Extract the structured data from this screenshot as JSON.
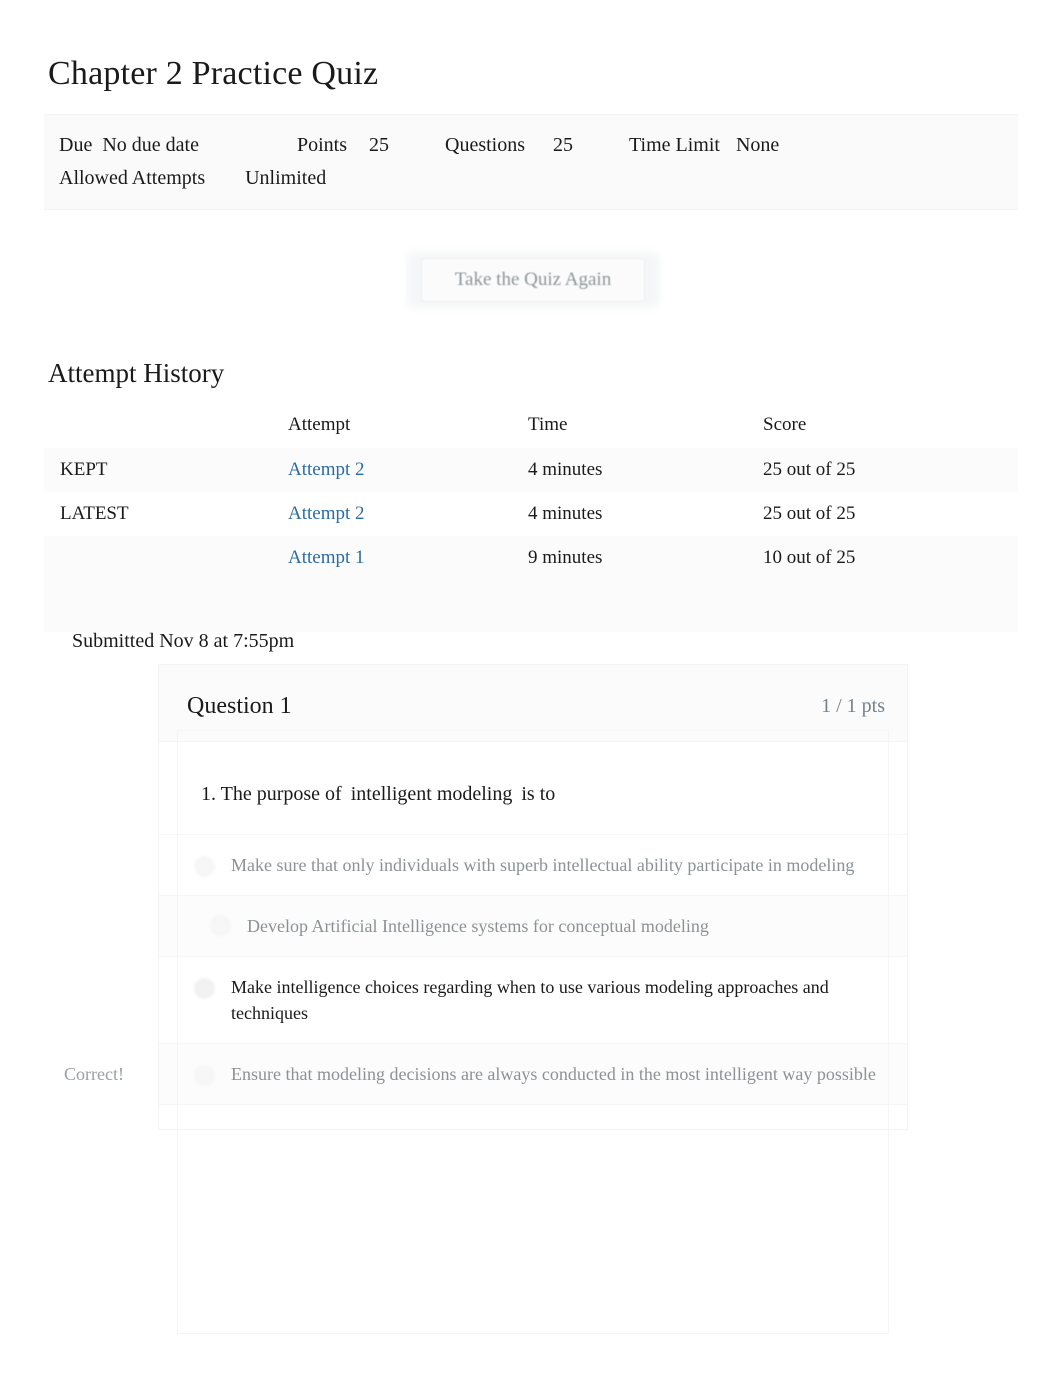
{
  "page": {
    "title": "Chapter 2 Practice Quiz"
  },
  "meta": {
    "due_label": "Due",
    "due_value": "No due date",
    "points_label": "Points",
    "points_value": "25",
    "questions_label": "Questions",
    "questions_value": "25",
    "time_limit_label": "Time Limit",
    "time_limit_value": "None",
    "allowed_attempts_label": "Allowed Attempts",
    "allowed_attempts_value": "Unlimited"
  },
  "actions": {
    "take_quiz_again": "Take the Quiz Again"
  },
  "attempt_history": {
    "heading": "Attempt History",
    "columns": [
      "",
      "Attempt",
      "Time",
      "Score"
    ],
    "rows": [
      {
        "flag": "KEPT",
        "attempt": "Attempt 2",
        "time": "4 minutes",
        "score": "25 out of 25"
      },
      {
        "flag": "LATEST",
        "attempt": "Attempt 2",
        "time": "4 minutes",
        "score": "25 out of 25"
      },
      {
        "flag": "",
        "attempt": "Attempt 1",
        "time": "9 minutes",
        "score": "10 out of 25"
      }
    ]
  },
  "submission": {
    "submitted_text": "Submitted Nov 8 at 7:55pm"
  },
  "question": {
    "name": "Question 1",
    "points": "1 / 1 pts",
    "text_prefix": "1. The purpose of",
    "text_emphasis": "intelligent modeling",
    "text_suffix": "is to",
    "correct_flag": "Correct!",
    "answers": [
      {
        "text": "Make sure that only individuals with superb intellectual ability participate in modeling",
        "selected": false
      },
      {
        "text": "Develop Artificial Intelligence systems for conceptual modeling",
        "selected": false
      },
      {
        "text": "Make intelligence choices regarding when to use various modeling approaches and techniques",
        "selected": true
      },
      {
        "text": "Ensure that modeling decisions are always conducted in the most intelligent way possible",
        "selected": false
      }
    ]
  },
  "colors": {
    "link": "#2b6ca3",
    "text": "#1a1a1a",
    "muted": "#8b9296",
    "panel": "#fafafa"
  }
}
